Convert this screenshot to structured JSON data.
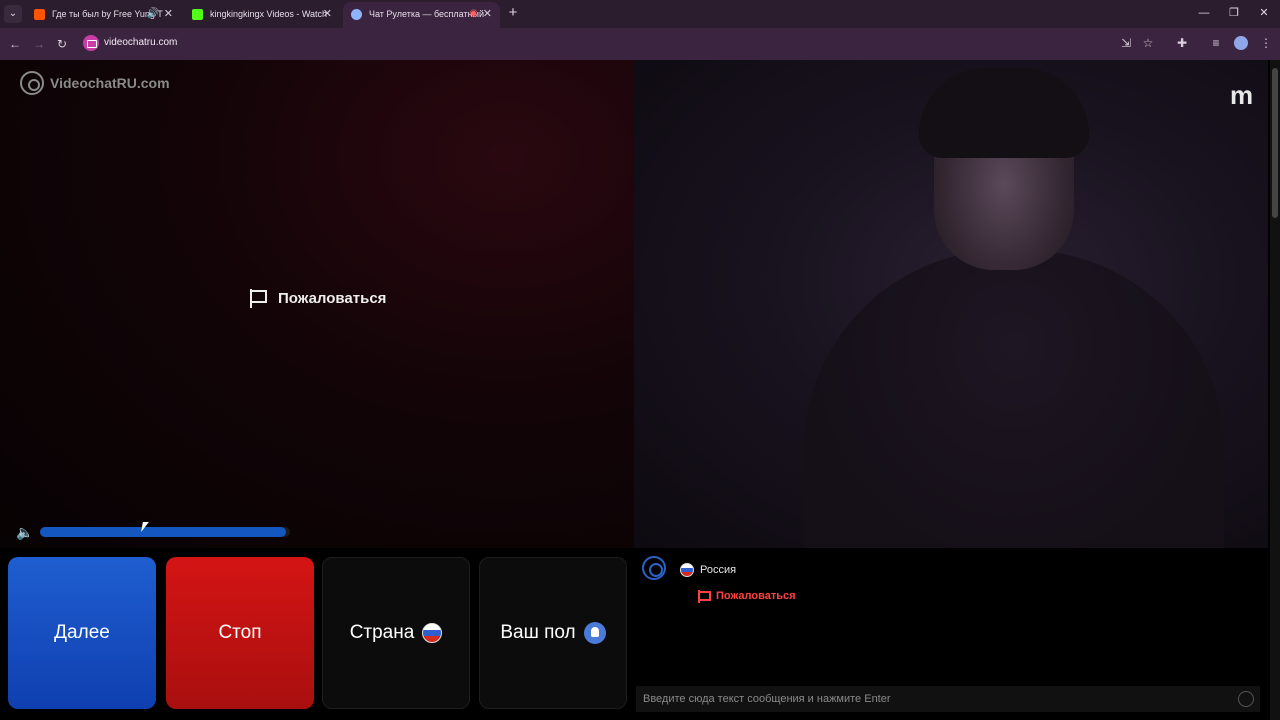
{
  "browser": {
    "tabs": [
      {
        "title": "Где ты был by Free Yung T",
        "icon": "soundcloud-icon",
        "color": "#ff5500"
      },
      {
        "title": "kingkingkingx Videos - Watch",
        "icon": "kick-icon",
        "color": "#53fc18"
      },
      {
        "title": "Чат Рулетка — бесплатный",
        "icon": "videochat-icon",
        "color": "#8fb4ff"
      }
    ],
    "url": "videochatru.com"
  },
  "page": {
    "brand": "VideochatRU.com",
    "report_label": "Пожаловаться",
    "volume_percent": 100,
    "buttons": {
      "next": "Далее",
      "stop": "Стоп",
      "country": "Страна",
      "gender": "Ваш пол"
    },
    "chat": {
      "country": "Россия",
      "report_label": "Пожаловаться",
      "input_placeholder": "Введите сюда текст сообщения и нажмите Enter"
    }
  }
}
